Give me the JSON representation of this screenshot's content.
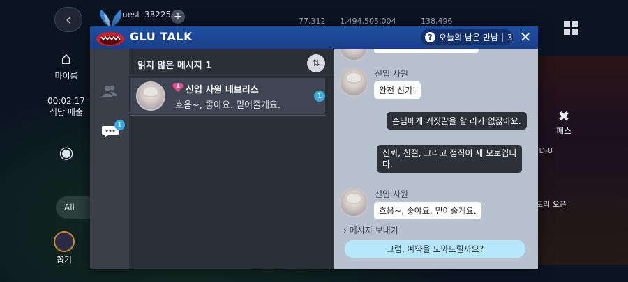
{
  "background": {
    "guest_name": "uest_33225",
    "resources": [
      "77,312",
      "1,494,505,004",
      "138,496"
    ],
    "left_menu": {
      "home_label": "마이룸",
      "timer": "00:02:17",
      "timer_label": "식당 매출",
      "all_label": "All",
      "gift_label": "뽑기"
    },
    "right_menu": {
      "pass_label": "패스",
      "d8_label": "D-8",
      "story_label": "토리 오픈"
    }
  },
  "dialog": {
    "title": "GLU TALK",
    "remaining_label": "오늘의 남은 만남",
    "remaining_count": "3",
    "close_icon": "close-icon"
  },
  "rail": {
    "chat_badge": "1"
  },
  "list": {
    "unread_title": "읽지 않은 메시지 1",
    "conversations": [
      {
        "heart_level": "1",
        "name": "신입 사원 네브리스",
        "preview": "흐음~, 좋아요. 믿어줄게요.",
        "unread": "1"
      }
    ]
  },
  "chat": {
    "messages": [
      {
        "from": "npc",
        "sender": "신입 사원",
        "text": "완전 신기!"
      },
      {
        "from": "me",
        "text": "손님에게 거짓말을 할 리가 없잖아요."
      },
      {
        "from": "me",
        "text_line1": "신뢰, 친절, 그리고 정직이 제 모토입니",
        "text_line2": "다."
      },
      {
        "from": "npc",
        "sender": "신입 사원",
        "text": "흐음~, 좋아요. 믿어줄게요."
      }
    ],
    "send_label": "메시지 보내기",
    "reply_option": "그럼, 예약을 도와드릴까요?"
  },
  "colors": {
    "header_blue": "#1e4fa3",
    "unread_badge": "#3aa8e0",
    "chat_bg": "#b8c2cf",
    "reply_bg": "#b7e7fb",
    "heart": "#e84a8a"
  }
}
